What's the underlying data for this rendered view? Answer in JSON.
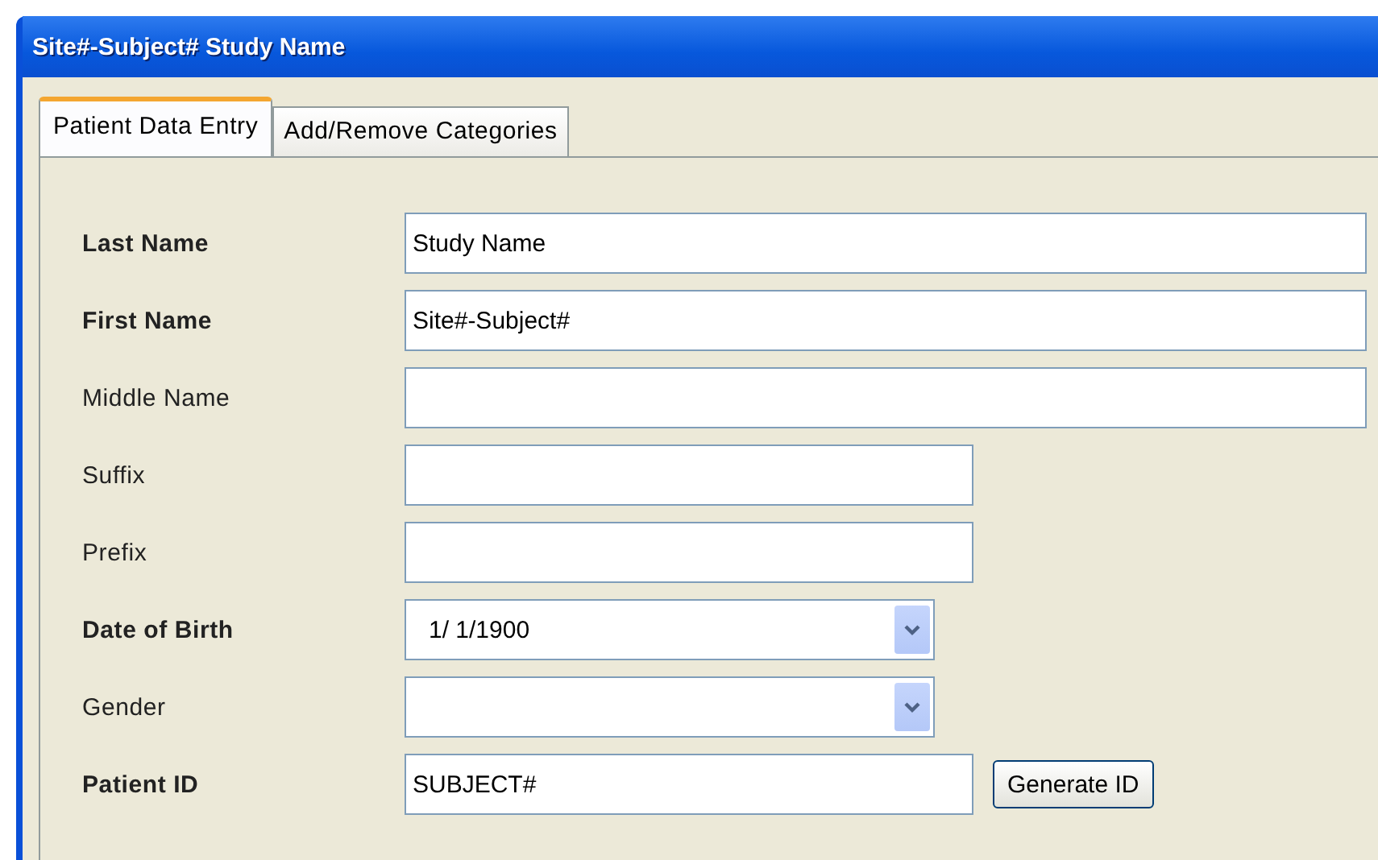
{
  "window": {
    "title": "Site#-Subject# Study Name"
  },
  "tabs": [
    {
      "label": "Patient Data Entry",
      "selected": true
    },
    {
      "label": "Add/Remove Categories",
      "selected": false
    }
  ],
  "fields": [
    {
      "label": "Last Name",
      "bold": true,
      "kind": "long",
      "value": "Study Name"
    },
    {
      "label": "First Name",
      "bold": true,
      "kind": "long",
      "value": "Site#-Subject#"
    },
    {
      "label": "Middle Name",
      "bold": false,
      "kind": "long"
    },
    {
      "label": "Suffix",
      "bold": false,
      "kind": "short"
    },
    {
      "label": "Prefix",
      "bold": false,
      "kind": "short"
    },
    {
      "label": "Date of Birth",
      "bold": true,
      "kind": "combo",
      "value": "1/  1/1900"
    },
    {
      "label": "Gender",
      "bold": false,
      "kind": "combo"
    },
    {
      "label": "Patient ID",
      "bold": true,
      "kind": "short",
      "value": "SUBJECT#",
      "button": "Generate ID"
    }
  ]
}
